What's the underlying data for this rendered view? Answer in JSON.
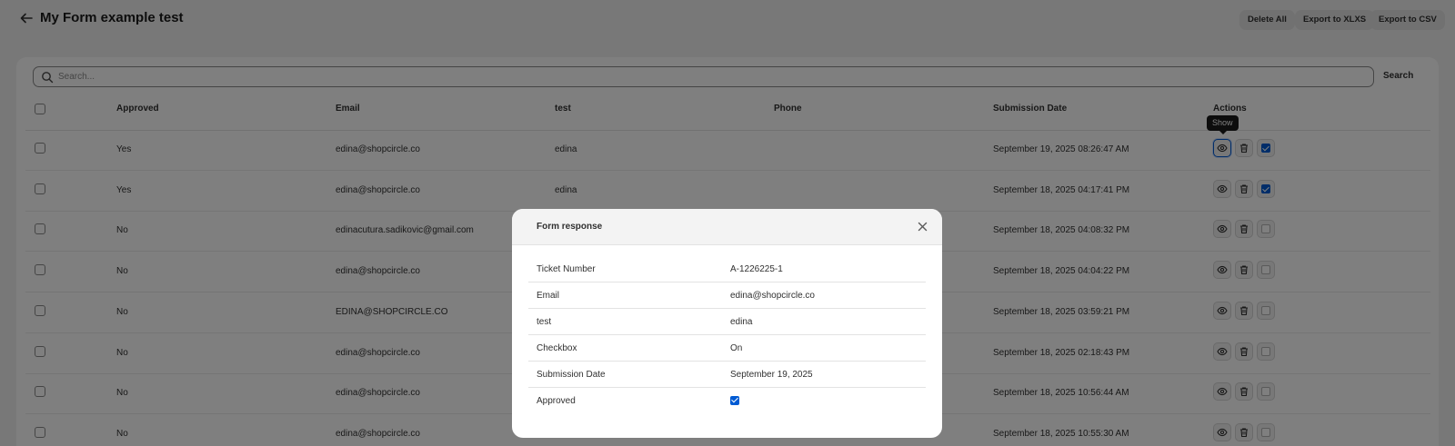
{
  "header": {
    "title": "My Form example test",
    "buttons": {
      "delete_all": "Delete All",
      "export_xlxs": "Export to XLXS",
      "export_csv": "Export to CSV"
    }
  },
  "search": {
    "placeholder": "Search...",
    "button": "Search"
  },
  "table": {
    "columns": {
      "approved": "Approved",
      "email": "Email",
      "test": "test",
      "phone": "Phone",
      "submission_date": "Submission Date",
      "actions": "Actions"
    },
    "rows": [
      {
        "approved": "Yes",
        "email": "edina@shopcircle.co",
        "test": "edina",
        "phone": "",
        "date": "September 19, 2025 08:26:47 AM",
        "approved_checked": true
      },
      {
        "approved": "Yes",
        "email": "edina@shopcircle.co",
        "test": "edina",
        "phone": "",
        "date": "September 18, 2025 04:17:41 PM",
        "approved_checked": true
      },
      {
        "approved": "No",
        "email": "edinacutura.sadikovic@gmail.com",
        "test": "",
        "phone": "",
        "date": "September 18, 2025 04:08:32 PM",
        "approved_checked": false
      },
      {
        "approved": "No",
        "email": "edina@shopcircle.co",
        "test": "",
        "phone": "",
        "date": "September 18, 2025 04:04:22 PM",
        "approved_checked": false
      },
      {
        "approved": "No",
        "email": "EDINA@SHOPCIRCLE.CO",
        "test": "",
        "phone": "",
        "date": "September 18, 2025 03:59:21 PM",
        "approved_checked": false
      },
      {
        "approved": "No",
        "email": "edina@shopcircle.co",
        "test": "",
        "phone": "",
        "date": "September 18, 2025 02:18:43 PM",
        "approved_checked": false
      },
      {
        "approved": "No",
        "email": "edina@shopcircle.co",
        "test": "",
        "phone": "",
        "date": "September 18, 2025 10:56:44 AM",
        "approved_checked": false
      },
      {
        "approved": "No",
        "email": "edina@shopcircle.co",
        "test": "",
        "phone": "",
        "date": "September 18, 2025 10:55:30 AM",
        "approved_checked": false
      }
    ]
  },
  "tooltip": {
    "text": "Show"
  },
  "modal": {
    "title": "Form response",
    "fields": [
      {
        "label": "Ticket Number",
        "value": "A-1226225-1"
      },
      {
        "label": "Email",
        "value": "edina@shopcircle.co"
      },
      {
        "label": "test",
        "value": "edina"
      },
      {
        "label": "Checkbox",
        "value": "On"
      },
      {
        "label": "Submission Date",
        "value": "September 19, 2025"
      },
      {
        "label": "Approved",
        "value": ""
      }
    ]
  },
  "colors": {
    "accent": "#005bd3",
    "background": "#f1f1f1",
    "overlay": "rgba(0,0,0,0.5)"
  },
  "icons": [
    "back-arrow-icon",
    "search-icon",
    "eye-icon",
    "trash-icon",
    "checkbox-icon",
    "close-icon"
  ]
}
